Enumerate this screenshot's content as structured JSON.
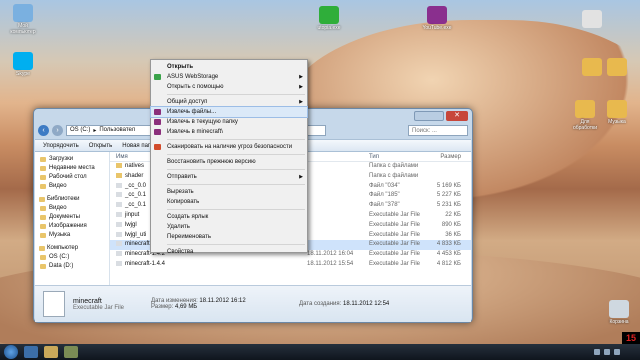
{
  "desktop": {
    "icons": [
      {
        "label": "Мой компьютер",
        "color": "#7ab0e0"
      },
      {
        "label": "Skype",
        "color": "#00aff0"
      },
      {
        "label": "utopia.exe",
        "color": "#2fae3a"
      },
      {
        "label": "YouTube.exe",
        "color": "#8a2f8e"
      },
      {
        "label": "",
        "color": "#e2e2e2"
      },
      {
        "label": "",
        "color": "#e8b94e"
      },
      {
        "label": "",
        "color": "#e8b94e"
      },
      {
        "label": "Для обработки",
        "color": "#e8b94e"
      },
      {
        "label": "Музыка",
        "color": "#e8b94e"
      },
      {
        "label": "Корзина",
        "color": "#cfd8e0"
      }
    ]
  },
  "window": {
    "address": "OS (C:)",
    "address_tail": "Пользовател",
    "search_placeholder": "Поиск: ...",
    "toolbar": [
      "Упорядочить",
      "Открыть",
      "Новая папка"
    ],
    "nav": [
      {
        "label": "Загрузки",
        "group": false
      },
      {
        "label": "Недавние места",
        "group": false
      },
      {
        "label": "Рабочий стол",
        "group": false
      },
      {
        "label": "Видео",
        "group": false
      },
      {
        "label": "Библиотеки",
        "group": true
      },
      {
        "label": "Видео",
        "group": false
      },
      {
        "label": "Документы",
        "group": false
      },
      {
        "label": "Изображения",
        "group": false
      },
      {
        "label": "Музыка",
        "group": false
      },
      {
        "label": "Компьютер",
        "group": true
      },
      {
        "label": "OS (C:)",
        "group": false
      },
      {
        "label": "Data (D:)",
        "group": false
      }
    ],
    "columns": [
      "Имя",
      "",
      "Тип",
      "Размер"
    ],
    "rows": [
      {
        "name": "natives",
        "date": "",
        "type": "Папка с файлами",
        "size": "",
        "sel": false
      },
      {
        "name": "shader",
        "date": "",
        "type": "Папка с файлами",
        "size": "",
        "sel": false
      },
      {
        "name": "_cc_0.0",
        "date": "",
        "type": "Файл \"034\"",
        "size": "5 169 КБ",
        "sel": false
      },
      {
        "name": "_cc_0.1",
        "date": "",
        "type": "Файл \"185\"",
        "size": "5 227 КБ",
        "sel": false
      },
      {
        "name": "_cc_0.1",
        "date": "",
        "type": "Файл \"378\"",
        "size": "5 231 КБ",
        "sel": false
      },
      {
        "name": "jinput",
        "date": "",
        "type": "Executable Jar File",
        "size": "22 КБ",
        "sel": false
      },
      {
        "name": "lwjgl",
        "date": "",
        "type": "Executable Jar File",
        "size": "890 КБ",
        "sel": false
      },
      {
        "name": "lwjgl_uti",
        "date": "",
        "type": "Executable Jar File",
        "size": "36 КБ",
        "sel": false
      },
      {
        "name": "minecraft",
        "date": "",
        "type": "Executable Jar File",
        "size": "4 833 КБ",
        "sel": true
      },
      {
        "name": "minecraft-1.4.2",
        "date": "18.11.2012 16:04",
        "type": "Executable Jar File",
        "size": "4 453 КБ",
        "sel": false
      },
      {
        "name": "minecraft-1.4.4",
        "date": "18.11.2012 15:54",
        "type": "Executable Jar File",
        "size": "4 812 КБ",
        "sel": false
      }
    ],
    "details": {
      "name": "minecraft",
      "kind": "Executable Jar File",
      "modified_label": "Дата изменения:",
      "modified": "18.11.2012 16:12",
      "created_label": "Дата создания:",
      "created": "18.11.2012 12:54",
      "size_label": "Размер:",
      "size": "4,69 МБ"
    }
  },
  "context_menu": [
    {
      "label": "Открыть",
      "bold": true,
      "sub": false,
      "icon": ""
    },
    {
      "label": "ASUS WebStorage",
      "bold": false,
      "sub": true,
      "icon": "#3aa34a"
    },
    {
      "label": "Открыть с помощью",
      "bold": false,
      "sub": true,
      "icon": ""
    },
    {
      "sep": true
    },
    {
      "label": "Общий доступ",
      "bold": false,
      "sub": true,
      "icon": ""
    },
    {
      "label": "Извлечь файлы...",
      "bold": false,
      "sub": false,
      "icon": "#8b2f7b",
      "hl": true
    },
    {
      "label": "Извлечь в текущую папку",
      "bold": false,
      "sub": false,
      "icon": "#8b2f7b"
    },
    {
      "label": "Извлечь в minecraft\\",
      "bold": false,
      "sub": false,
      "icon": "#8b2f7b"
    },
    {
      "sep": true
    },
    {
      "label": "Сканировать на наличие угроз безопасности",
      "bold": false,
      "sub": false,
      "icon": "#d24b2a"
    },
    {
      "sep": true
    },
    {
      "label": "Восстановить прежнюю версию",
      "bold": false,
      "sub": false,
      "icon": ""
    },
    {
      "sep": true
    },
    {
      "label": "Отправить",
      "bold": false,
      "sub": true,
      "icon": ""
    },
    {
      "sep": true
    },
    {
      "label": "Вырезать",
      "bold": false,
      "sub": false,
      "icon": ""
    },
    {
      "label": "Копировать",
      "bold": false,
      "sub": false,
      "icon": ""
    },
    {
      "sep": true
    },
    {
      "label": "Создать ярлык",
      "bold": false,
      "sub": false,
      "icon": ""
    },
    {
      "label": "Удалить",
      "bold": false,
      "sub": false,
      "icon": ""
    },
    {
      "label": "Переименовать",
      "bold": false,
      "sub": false,
      "icon": ""
    },
    {
      "sep": true
    },
    {
      "label": "Свойства",
      "bold": false,
      "sub": false,
      "icon": ""
    }
  ],
  "recording_badge": "15"
}
